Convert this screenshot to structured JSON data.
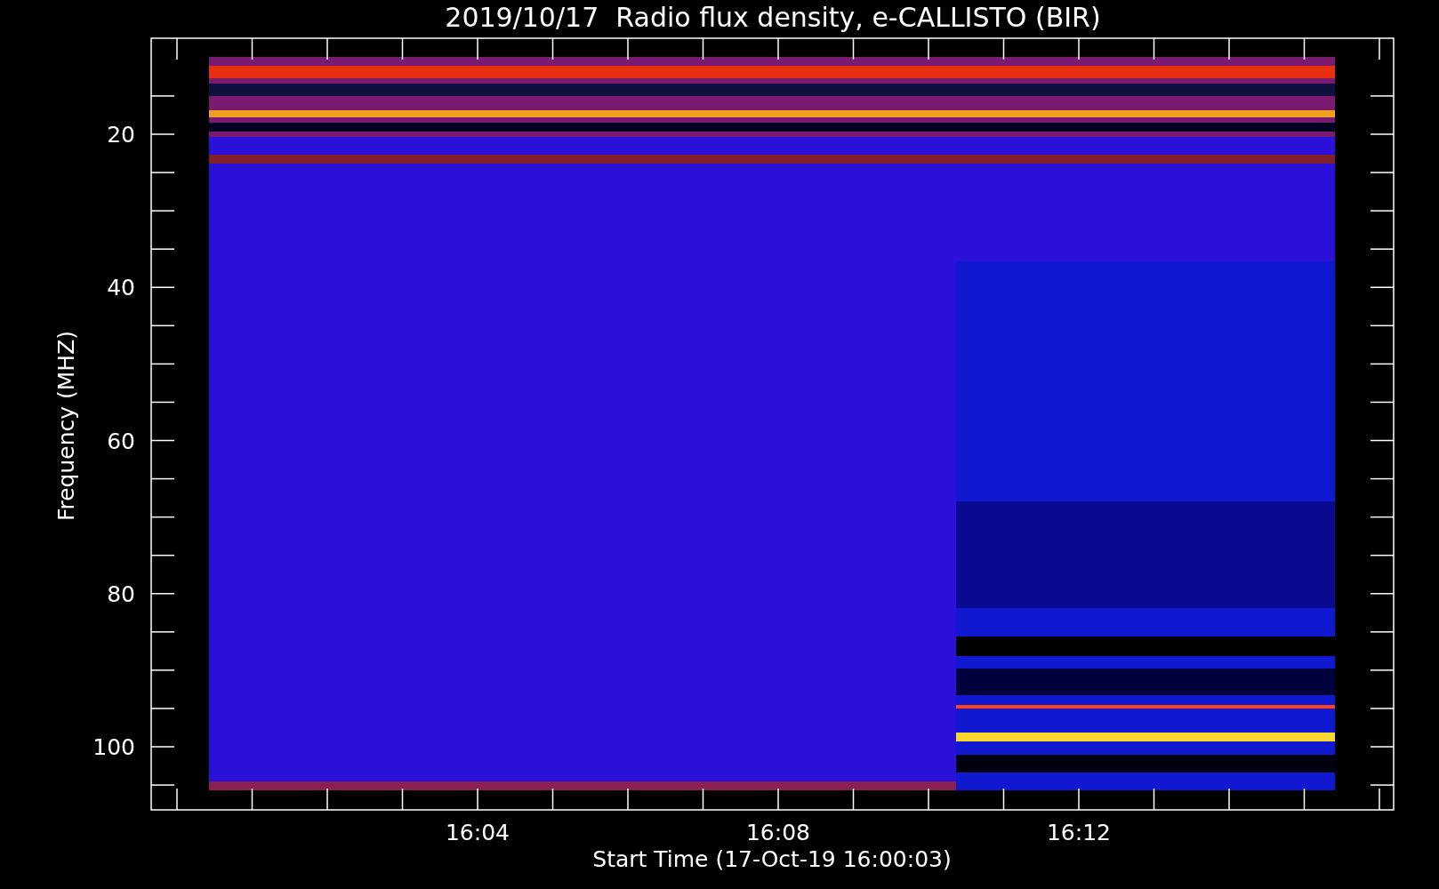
{
  "title": "2019/10/17  Radio flux density, e-CALLISTO (BIR)",
  "y_axis": {
    "label": "Frequency (MHZ)",
    "ticks": [
      {
        "label": "20"
      },
      {
        "label": "40"
      },
      {
        "label": "60"
      },
      {
        "label": "80"
      },
      {
        "label": "100"
      }
    ]
  },
  "x_axis": {
    "label": "Start Time (17-Oct-19 16:00:03)",
    "ticks": [
      {
        "label": "16:04"
      },
      {
        "label": "16:08"
      },
      {
        "label": "16:12"
      }
    ]
  }
}
